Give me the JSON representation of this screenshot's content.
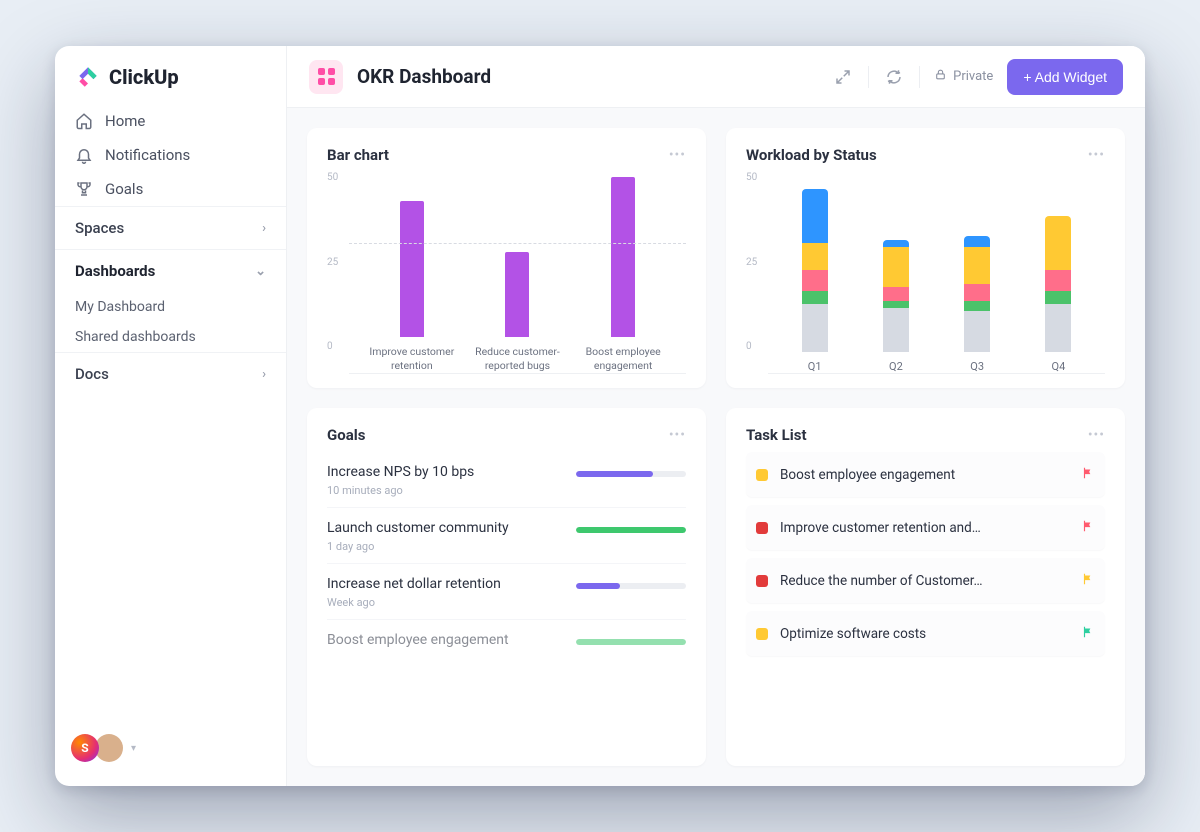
{
  "brand": "ClickUp",
  "sidebar": {
    "nav": [
      {
        "label": "Home",
        "icon": "home-icon"
      },
      {
        "label": "Notifications",
        "icon": "bell-icon"
      },
      {
        "label": "Goals",
        "icon": "trophy-icon"
      }
    ],
    "sections": {
      "spaces": "Spaces",
      "dashboards": "Dashboards",
      "dashboard_items": [
        "My Dashboard",
        "Shared dashboards"
      ],
      "docs": "Docs"
    }
  },
  "header": {
    "title": "OKR Dashboard",
    "private": "Private",
    "add_widget": "+ Add Widget"
  },
  "cards": {
    "bar": {
      "title": "Bar chart"
    },
    "workload": {
      "title": "Workload by Status"
    },
    "goals": {
      "title": "Goals",
      "items": [
        {
          "name": "Increase NPS by 10 bps",
          "time": "10 minutes ago",
          "pct": 70,
          "color": "#7b68ee"
        },
        {
          "name": "Launch customer community",
          "time": "1 day ago",
          "pct": 100,
          "color": "#3ec86e"
        },
        {
          "name": "Increase net dollar retention",
          "time": "Week ago",
          "pct": 40,
          "color": "#7b68ee"
        },
        {
          "name": "Boost employee engagement",
          "time": "",
          "pct": 100,
          "color": "#3ec86e"
        }
      ]
    },
    "tasks": {
      "title": "Task List",
      "items": [
        {
          "name": "Boost employee engagement",
          "sq": "#ffc933",
          "flag": "#ff5a6e"
        },
        {
          "name": "Improve customer retention and…",
          "sq": "#e23b3b",
          "flag": "#ff5a6e"
        },
        {
          "name": "Reduce the number of Customer…",
          "sq": "#e23b3b",
          "flag": "#ffc933"
        },
        {
          "name": "Optimize software costs",
          "sq": "#ffc933",
          "flag": "#2ecfa0"
        }
      ]
    }
  },
  "chart_data": [
    {
      "id": "bar_chart",
      "type": "bar",
      "title": "Bar chart",
      "categories": [
        "Improve customer retention",
        "Reduce customer-reported bugs",
        "Boost employee engagement"
      ],
      "values": [
        40,
        25,
        47
      ],
      "ylim": [
        0,
        50
      ],
      "yticks": [
        0,
        25,
        50
      ],
      "reference_line": 32,
      "color": "#b352e6"
    },
    {
      "id": "workload_by_status",
      "type": "bar_stacked",
      "title": "Workload by Status",
      "categories": [
        "Q1",
        "Q2",
        "Q3",
        "Q4"
      ],
      "ylim": [
        0,
        50
      ],
      "yticks": [
        0,
        25,
        50
      ],
      "series": [
        {
          "name": "grey",
          "color": "#d6dae2",
          "values": [
            14,
            13,
            12,
            14
          ]
        },
        {
          "name": "green",
          "color": "#4bc26a",
          "values": [
            4,
            2,
            3,
            4
          ]
        },
        {
          "name": "pink",
          "color": "#ff6e8a",
          "values": [
            6,
            4,
            5,
            6
          ]
        },
        {
          "name": "yellow",
          "color": "#ffc933",
          "values": [
            8,
            12,
            11,
            16
          ]
        },
        {
          "name": "blue",
          "color": "#2e95ff",
          "values": [
            16,
            2,
            3,
            0
          ]
        }
      ]
    }
  ]
}
